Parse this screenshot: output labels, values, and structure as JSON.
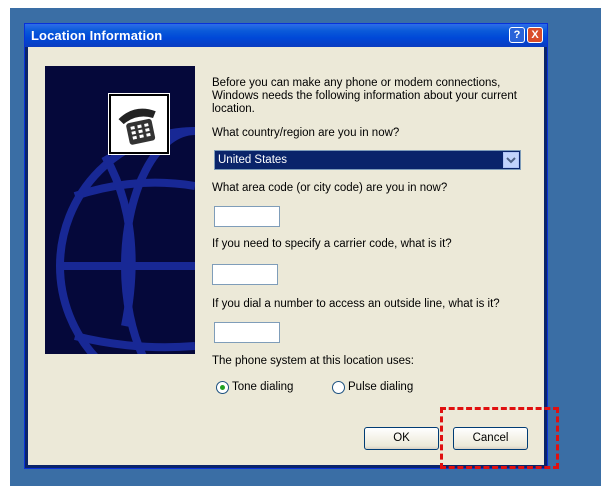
{
  "window": {
    "title": "Location Information",
    "help_glyph": "?",
    "close_glyph": "X"
  },
  "dialog": {
    "intro": "Before you can make any phone or modem connections, Windows needs the following information about your current location.",
    "country_label": "What country/region are you in now?",
    "country_value": "United States",
    "area_label": "What area code (or city code) are you in now?",
    "area_value": "",
    "carrier_label": "If you need to specify a carrier code, what is it?",
    "carrier_value": "",
    "outside_label": "If you dial a number to access an outside line, what is it?",
    "outside_value": "",
    "system_label": "The phone system at this location uses:",
    "tone_label": "Tone dialing",
    "pulse_label": "Pulse dialing",
    "selected_dialing": "tone",
    "ok_label": "OK",
    "cancel_label": "Cancel"
  },
  "icons": [
    "phone-icon",
    "globe-art",
    "chevron-down-icon",
    "help-icon",
    "close-icon"
  ],
  "colors": {
    "desktop": "#3a6ea5",
    "titlebar": "#0a5ad9",
    "dialog_face": "#ece9d8",
    "selection": "#0a246a",
    "highlight": "#e01010"
  }
}
